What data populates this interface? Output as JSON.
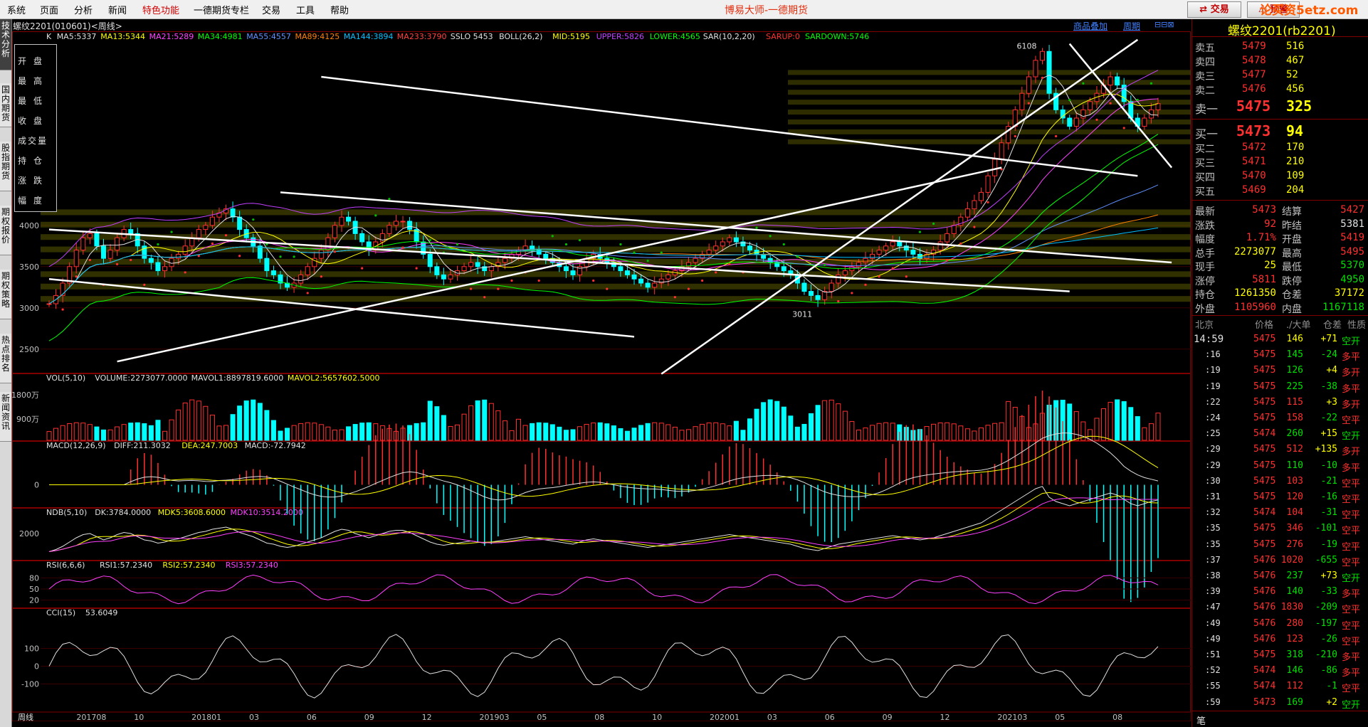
{
  "menu": {
    "items": [
      "系统",
      "页面",
      "分析",
      "新闻",
      "特色功能",
      "一德期货专栏",
      "交易",
      "工具",
      "帮助"
    ],
    "app_title": "博易大师-一德期货",
    "trade_label": "交易",
    "alert_label": "预警",
    "watermark": "论买资5etz.com"
  },
  "left_tabs": [
    {
      "label": "技术分析",
      "active": true
    },
    {
      "label": "国内期货",
      "active": false
    },
    {
      "label": "股指期货",
      "active": false
    },
    {
      "label": "期权报价",
      "active": false
    },
    {
      "label": "期权策略",
      "active": false
    },
    {
      "label": "热点排名",
      "active": false
    },
    {
      "label": "新闻资讯",
      "active": false
    }
  ],
  "header": {
    "title": "螺纹2201(010601)<周线>",
    "link_overlay": "商品叠加",
    "link_period": "周期"
  },
  "colors": {
    "ma5": "#e0e0e0",
    "ma13": "#ffff00",
    "ma21": "#ff40ff",
    "ma34": "#00ff00",
    "ma55": "#6090ff",
    "ma89": "#ff8000",
    "ma144": "#00c0ff",
    "ma233": "#ff4040",
    "boll_mid": "#ffff00",
    "boll_upper": "#c040ff",
    "boll_lower": "#00ff00",
    "up": "#ff3030",
    "down": "#00ffff",
    "sar_up": "#ff3030",
    "sar_down": "#00c000",
    "border": "#800000",
    "trend": "#ffffff"
  },
  "legend_fields": [
    "开盘",
    "最高",
    "最低",
    "收盘",
    "成交量",
    "持仓",
    "涨跌",
    "幅度"
  ],
  "indicators": {
    "k": [
      {
        "text": "K",
        "color": "#e0e0e0"
      },
      {
        "text": "MA5:5337",
        "color": "#e0e0e0"
      },
      {
        "text": "MA13:5344",
        "color": "#ffff00"
      },
      {
        "text": "MA21:5289",
        "color": "#ff40ff"
      },
      {
        "text": "MA34:4981",
        "color": "#00ff00"
      },
      {
        "text": "MA55:4557",
        "color": "#6090ff"
      },
      {
        "text": "MA89:4125",
        "color": "#ff8000"
      },
      {
        "text": "MA144:3894",
        "color": "#00c0ff"
      },
      {
        "text": "MA233:3790",
        "color": "#ff4040"
      },
      {
        "text": "SSLO 5453",
        "color": "#e0e0e0"
      },
      {
        "text": "BOLL(26,2)",
        "color": "#e0e0e0"
      },
      {
        "text": "MID:5195",
        "color": "#ffff00"
      },
      {
        "text": "UPPER:5826",
        "color": "#c040ff"
      },
      {
        "text": "LOWER:4565",
        "color": "#00ff00"
      },
      {
        "text": "SAR(10,2,20)",
        "color": "#e0e0e0"
      },
      {
        "text": "SARUP:0",
        "color": "#ff3030"
      },
      {
        "text": "SARDOWN:5746",
        "color": "#00ff00"
      }
    ],
    "vol": [
      {
        "text": "VOL(5,10)",
        "color": "#e0e0e0"
      },
      {
        "text": "VOLUME:2273077.0000",
        "color": "#e0e0e0"
      },
      {
        "text": "MAVOL1:8897819.6000",
        "color": "#e0e0e0"
      },
      {
        "text": "MAVOL2:5657602.5000",
        "color": "#ffff00"
      }
    ],
    "macd": [
      {
        "text": "MACD(12,26,9)",
        "color": "#e0e0e0"
      },
      {
        "text": "DIFF:211.3032",
        "color": "#e0e0e0"
      },
      {
        "text": "DEA:247.7003",
        "color": "#ffff00"
      },
      {
        "text": "MACD:-72.7942",
        "color": "#e0e0e0"
      }
    ],
    "ndb": [
      {
        "text": "NDB(5,10)",
        "color": "#e0e0e0"
      },
      {
        "text": "DK:3784.0000",
        "color": "#e0e0e0"
      },
      {
        "text": "MDK5:3608.6000",
        "color": "#ffff00"
      },
      {
        "text": "MDK10:3514.2000",
        "color": "#ff40ff"
      }
    ],
    "rsi": [
      {
        "text": "RSI(6,6,6)",
        "color": "#e0e0e0"
      },
      {
        "text": "RSI1:57.2340",
        "color": "#e0e0e0"
      },
      {
        "text": "RSI2:57.2340",
        "color": "#ffff00"
      },
      {
        "text": "RSI3:57.2340",
        "color": "#ff40ff"
      }
    ],
    "cci": [
      {
        "text": "CCI(15)",
        "color": "#e0e0e0"
      },
      {
        "text": "53.6049",
        "color": "#e0e0e0"
      }
    ]
  },
  "chart_data": {
    "type": "candlestick",
    "price_axis": {
      "ticks": [
        2500,
        3000,
        3500,
        4000
      ],
      "range": [
        2300,
        6300
      ]
    },
    "annotations": [
      {
        "label": "6108",
        "value": 6108,
        "date": "2021-05"
      },
      {
        "label": "3011",
        "value": 3011,
        "date": "2020-03"
      }
    ],
    "x_labels": [
      "周线",
      "201708",
      "10",
      "201801",
      "03",
      "06",
      "09",
      "12",
      "201903",
      "05",
      "08",
      "10",
      "202001",
      "03",
      "06",
      "09",
      "12",
      "202103",
      "05",
      "08"
    ],
    "vol_axis": {
      "ticks": [
        "1800万",
        "900万"
      ],
      "max": 20000000
    },
    "macd_axis": {
      "ticks": [
        "0"
      ]
    },
    "ndb_axis": {
      "ticks": [
        "2000"
      ]
    },
    "rsi_axis": {
      "ticks": [
        "80",
        "50",
        "20"
      ]
    },
    "cci_axis": {
      "ticks": [
        "100",
        "0",
        "-100"
      ]
    },
    "close_series": [
      3050,
      3150,
      3300,
      3500,
      3700,
      3850,
      3900,
      3750,
      3600,
      3700,
      3850,
      3950,
      3900,
      3750,
      3600,
      3550,
      3450,
      3500,
      3600,
      3650,
      3750,
      3850,
      3950,
      4000,
      4100,
      4150,
      4200,
      4100,
      3950,
      3850,
      3750,
      3600,
      3450,
      3400,
      3300,
      3250,
      3300,
      3400,
      3500,
      3600,
      3700,
      3850,
      4000,
      4100,
      4050,
      3900,
      3800,
      3700,
      3800,
      3900,
      4000,
      4050,
      4050,
      3950,
      3800,
      3650,
      3500,
      3400,
      3350,
      3400,
      3450,
      3500,
      3550,
      3500,
      3450,
      3500,
      3550,
      3600,
      3650,
      3700,
      3750,
      3700,
      3650,
      3600,
      3550,
      3500,
      3450,
      3400,
      3500,
      3600,
      3650,
      3600,
      3550,
      3500,
      3450,
      3400,
      3350,
      3300,
      3250,
      3300,
      3350,
      3400,
      3450,
      3500,
      3550,
      3600,
      3650,
      3700,
      3750,
      3800,
      3850,
      3800,
      3750,
      3700,
      3650,
      3600,
      3550,
      3500,
      3450,
      3400,
      3300,
      3200,
      3150,
      3100,
      3200,
      3300,
      3400,
      3450,
      3500,
      3550,
      3600,
      3650,
      3700,
      3750,
      3800,
      3750,
      3700,
      3650,
      3600,
      3650,
      3700,
      3800,
      3900,
      4000,
      4100,
      4200,
      4300,
      4400,
      4600,
      4800,
      5000,
      5200,
      5400,
      5600,
      5800,
      6000,
      6108,
      5600,
      5400,
      5300,
      5200,
      5300,
      5400,
      5500,
      5600,
      5700,
      5800,
      5700,
      5500,
      5300,
      5200,
      5300,
      5400,
      5475
    ]
  },
  "quote": {
    "title": "螺纹2201(rb2201)",
    "asks": [
      {
        "label": "卖五",
        "price": "5479",
        "vol": "516"
      },
      {
        "label": "卖四",
        "price": "5478",
        "vol": "467"
      },
      {
        "label": "卖三",
        "price": "5477",
        "vol": "52"
      },
      {
        "label": "卖二",
        "price": "5476",
        "vol": "456"
      },
      {
        "label": "卖一",
        "price": "5475",
        "vol": "325"
      }
    ],
    "bids": [
      {
        "label": "买一",
        "price": "5473",
        "vol": "94"
      },
      {
        "label": "买二",
        "price": "5472",
        "vol": "170"
      },
      {
        "label": "买三",
        "price": "5471",
        "vol": "210"
      },
      {
        "label": "买四",
        "price": "5470",
        "vol": "109"
      },
      {
        "label": "买五",
        "price": "5469",
        "vol": "204"
      }
    ],
    "stats": [
      {
        "l1": "最新",
        "v1": "5473",
        "c1": "red",
        "l2": "结算",
        "v2": "5427",
        "c2": "red"
      },
      {
        "l1": "涨跌",
        "v1": "92",
        "c1": "red",
        "l2": "昨结",
        "v2": "5381",
        "c2": "white"
      },
      {
        "l1": "幅度",
        "v1": "1.71%",
        "c1": "red",
        "l2": "开盘",
        "v2": "5419",
        "c2": "red"
      },
      {
        "l1": "总手",
        "v1": "2273077",
        "c1": "yellow",
        "l2": "最高",
        "v2": "5495",
        "c2": "red"
      },
      {
        "l1": "现手",
        "v1": "25",
        "c1": "yellow",
        "l2": "最低",
        "v2": "5370",
        "c2": "green"
      },
      {
        "l1": "涨停",
        "v1": "5811",
        "c1": "red",
        "l2": "跌停",
        "v2": "4950",
        "c2": "green"
      },
      {
        "l1": "持仓",
        "v1": "1261350",
        "c1": "yellow",
        "l2": "仓差",
        "v2": "37172",
        "c2": "yellow"
      },
      {
        "l1": "外盘",
        "v1": "1105960",
        "c1": "red",
        "l2": "内盘",
        "v2": "1167118",
        "c2": "green"
      }
    ],
    "tick_header": {
      "loc": "北京",
      "price": "价格",
      "bigvol": "./大单",
      "oi": "仓差",
      "nature": "性质"
    },
    "ticks": [
      {
        "t": "14:59",
        "p": "5475",
        "v": "146",
        "oi": "+71",
        "n": "空开",
        "pc": "red",
        "vc": "yellow",
        "oc": "yellow",
        "nc": "green"
      },
      {
        "t": ":16",
        "p": "5475",
        "v": "145",
        "oi": "-24",
        "n": "多平",
        "pc": "red",
        "vc": "green",
        "oc": "green",
        "nc": "red"
      },
      {
        "t": ":19",
        "p": "5475",
        "v": "126",
        "oi": "+4",
        "n": "多开",
        "pc": "red",
        "vc": "green",
        "oc": "yellow",
        "nc": "red"
      },
      {
        "t": ":19",
        "p": "5475",
        "v": "225",
        "oi": "-38",
        "n": "多平",
        "pc": "red",
        "vc": "green",
        "oc": "green",
        "nc": "red"
      },
      {
        "t": ":22",
        "p": "5475",
        "v": "115",
        "oi": "+3",
        "n": "多开",
        "pc": "red",
        "vc": "red",
        "oc": "yellow",
        "nc": "red"
      },
      {
        "t": ":24",
        "p": "5475",
        "v": "158",
        "oi": "-22",
        "n": "空平",
        "pc": "red",
        "vc": "red",
        "oc": "green",
        "nc": "red"
      },
      {
        "t": ":25",
        "p": "5474",
        "v": "260",
        "oi": "+15",
        "n": "空开",
        "pc": "red",
        "vc": "green",
        "oc": "yellow",
        "nc": "green"
      },
      {
        "t": ":29",
        "p": "5475",
        "v": "512",
        "oi": "+135",
        "n": "多开",
        "pc": "red",
        "vc": "red",
        "oc": "yellow",
        "nc": "red"
      },
      {
        "t": ":29",
        "p": "5475",
        "v": "110",
        "oi": "-10",
        "n": "多平",
        "pc": "red",
        "vc": "green",
        "oc": "green",
        "nc": "red"
      },
      {
        "t": ":30",
        "p": "5475",
        "v": "103",
        "oi": "-21",
        "n": "空平",
        "pc": "red",
        "vc": "red",
        "oc": "green",
        "nc": "red"
      },
      {
        "t": ":31",
        "p": "5475",
        "v": "120",
        "oi": "-16",
        "n": "空平",
        "pc": "red",
        "vc": "red",
        "oc": "green",
        "nc": "red"
      },
      {
        "t": ":32",
        "p": "5474",
        "v": "104",
        "oi": "-31",
        "n": "空平",
        "pc": "red",
        "vc": "red",
        "oc": "green",
        "nc": "red"
      },
      {
        "t": ":35",
        "p": "5475",
        "v": "346",
        "oi": "-101",
        "n": "空平",
        "pc": "red",
        "vc": "red",
        "oc": "green",
        "nc": "red"
      },
      {
        "t": ":35",
        "p": "5475",
        "v": "276",
        "oi": "-19",
        "n": "空平",
        "pc": "red",
        "vc": "red",
        "oc": "green",
        "nc": "red"
      },
      {
        "t": ":37",
        "p": "5476",
        "v": "1020",
        "oi": "-655",
        "n": "空平",
        "pc": "red",
        "vc": "red",
        "oc": "green",
        "nc": "red"
      },
      {
        "t": ":38",
        "p": "5476",
        "v": "237",
        "oi": "+73",
        "n": "空开",
        "pc": "red",
        "vc": "green",
        "oc": "yellow",
        "nc": "green"
      },
      {
        "t": ":39",
        "p": "5476",
        "v": "140",
        "oi": "-33",
        "n": "多平",
        "pc": "red",
        "vc": "green",
        "oc": "green",
        "nc": "red"
      },
      {
        "t": ":47",
        "p": "5476",
        "v": "1830",
        "oi": "-209",
        "n": "空平",
        "pc": "red",
        "vc": "red",
        "oc": "green",
        "nc": "red"
      },
      {
        "t": ":49",
        "p": "5476",
        "v": "280",
        "oi": "-197",
        "n": "空平",
        "pc": "red",
        "vc": "red",
        "oc": "green",
        "nc": "red"
      },
      {
        "t": ":49",
        "p": "5476",
        "v": "123",
        "oi": "-26",
        "n": "空平",
        "pc": "red",
        "vc": "red",
        "oc": "green",
        "nc": "red"
      },
      {
        "t": ":51",
        "p": "5475",
        "v": "318",
        "oi": "-210",
        "n": "多平",
        "pc": "red",
        "vc": "green",
        "oc": "green",
        "nc": "red"
      },
      {
        "t": ":52",
        "p": "5474",
        "v": "146",
        "oi": "-86",
        "n": "多平",
        "pc": "red",
        "vc": "green",
        "oc": "green",
        "nc": "red"
      },
      {
        "t": ":55",
        "p": "5474",
        "v": "112",
        "oi": "-1",
        "n": "空平",
        "pc": "red",
        "vc": "red",
        "oc": "green",
        "nc": "red"
      },
      {
        "t": ":59",
        "p": "5473",
        "v": "169",
        "oi": "+2",
        "n": "空开",
        "pc": "red",
        "vc": "green",
        "oc": "yellow",
        "nc": "green"
      }
    ],
    "footer": "笔"
  }
}
